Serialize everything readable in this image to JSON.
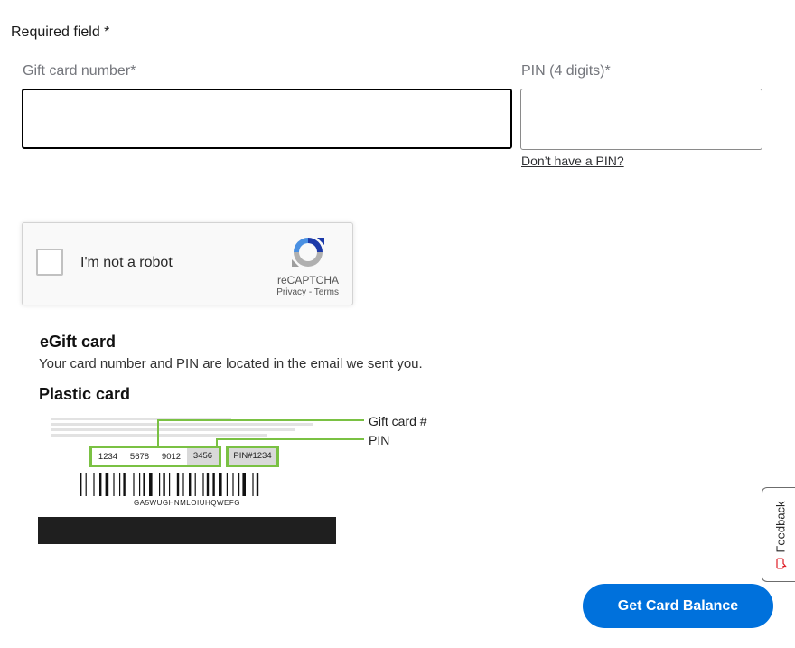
{
  "form": {
    "required_note": "Required field *",
    "gift_card_label": "Gift card number*",
    "gift_card_value": "",
    "pin_label": "PIN (4 digits)*",
    "pin_value": "",
    "no_pin_link": "Don’t have a PIN?"
  },
  "recaptcha": {
    "checkbox_label": "I'm not a robot",
    "checked": false,
    "brand": "reCAPTCHA",
    "privacy": "Privacy",
    "separator": " - ",
    "terms": "Terms",
    "icon": "recaptcha-logo-icon"
  },
  "help": {
    "egift_heading": "eGift card",
    "egift_text": "Your card number and PIN are located in the email we sent you.",
    "plastic_heading": "Plastic card",
    "card_numbers": [
      "1234",
      "5678",
      "9012",
      "3456"
    ],
    "card_pin": "PIN#1234",
    "barcode_text": "GA5WUGHNMLOIUHQWEFG",
    "callout_gift_card": "Gift card #",
    "callout_pin": "PIN",
    "accent_color": "#7ac143"
  },
  "feedback": {
    "label": "Feedback",
    "icon": "speech-bubble-icon",
    "icon_color": "#de1c24"
  },
  "actions": {
    "submit_label": "Get Card Balance",
    "submit_color": "#0071dc"
  }
}
